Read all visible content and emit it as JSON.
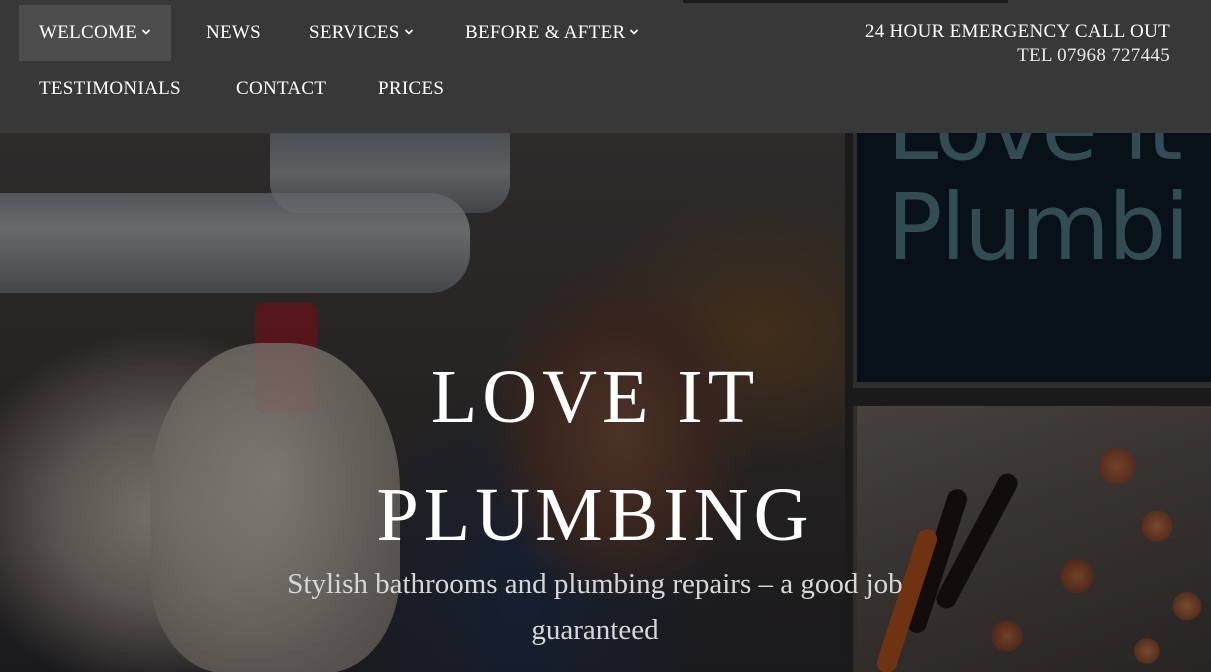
{
  "nav": {
    "items": [
      {
        "label": "WELCOME",
        "has_dropdown": true,
        "active": true
      },
      {
        "label": "NEWS",
        "has_dropdown": false,
        "active": false
      },
      {
        "label": "SERVICES",
        "has_dropdown": true,
        "active": false
      },
      {
        "label": "BEFORE & AFTER",
        "has_dropdown": true,
        "active": false
      },
      {
        "label": "TESTIMONIALS",
        "has_dropdown": false,
        "active": false
      },
      {
        "label": "CONTACT",
        "has_dropdown": false,
        "active": false
      },
      {
        "label": "PRICES",
        "has_dropdown": false,
        "active": false
      }
    ],
    "dropdown_icon": "chevron-down-icon"
  },
  "emergency": {
    "line1": "24 HOUR EMERGENCY CALL OUT",
    "line2": "TEL 07968 727445"
  },
  "hero": {
    "title_line1": "LOVE IT",
    "title_line2": "PLUMBING",
    "subtitle": "Stylish bathrooms and plumbing repairs – a good job guaranteed",
    "sign_line1": "Love it",
    "sign_line2": "Plumbi"
  },
  "colors": {
    "navbar_bg": "#383838",
    "active_item_bg": "#4d4d4d",
    "text": "#ffffff",
    "sign_text": "#5f8d96"
  }
}
